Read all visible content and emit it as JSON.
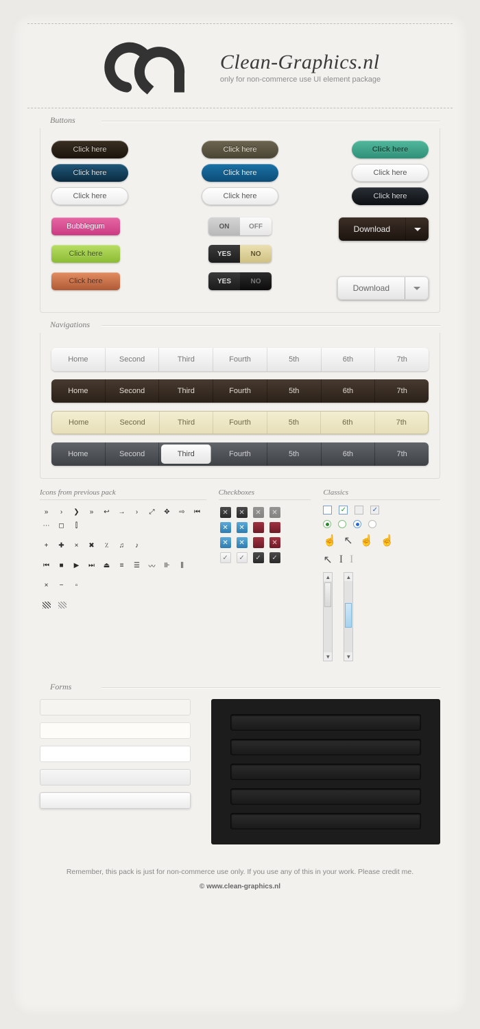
{
  "header": {
    "title": "Clean-Graphics.nl",
    "subtitle": "only for non-commerce use UI element package"
  },
  "sections": {
    "buttons": "Buttons",
    "navigations": "Navigations",
    "icons": "Icons from previous pack",
    "checkboxes": "Checkboxes",
    "classics": "Classics",
    "forms": "Forms"
  },
  "buttons": {
    "click_here": "Click here",
    "bubblegum": "Bubblegum",
    "download": "Download",
    "on": "ON",
    "off": "OFF",
    "yes": "YES",
    "no": "NO"
  },
  "nav_items": [
    "Home",
    "Second",
    "Third",
    "Fourth",
    "5th",
    "6th",
    "7th"
  ],
  "nav_active_index": 2,
  "footer": {
    "note": "Remember, this pack is just for non-commerce use only. If you use any of this in your work. Please credit me.",
    "copyright": "© www.clean-graphics.nl"
  }
}
